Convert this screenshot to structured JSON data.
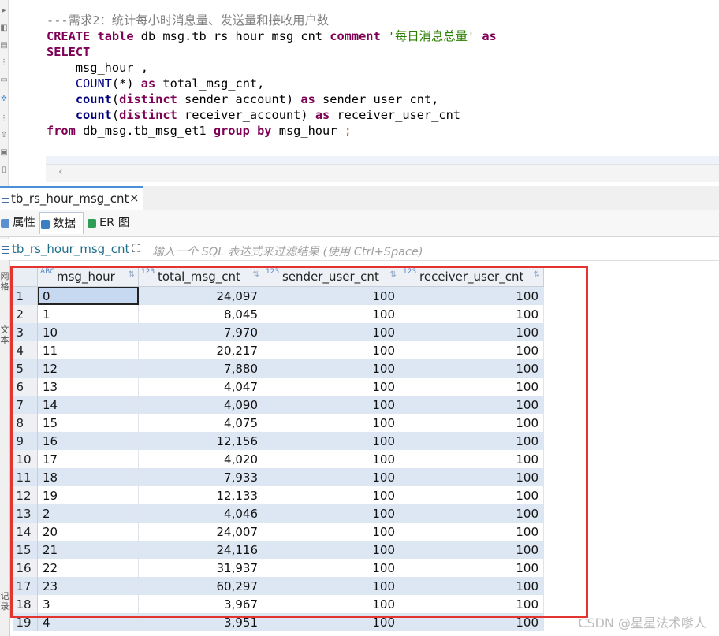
{
  "editor": {
    "comment": "---需求2：统计每小时消息量、发送量和接收用户数",
    "line2": {
      "kw1": "CREATE",
      "kw2": "table",
      "name": "db_msg.tb_rs_hour_msg_cnt",
      "kw3": "comment",
      "str": "'每日消息总量'",
      "kw4": "as"
    },
    "line3": "SELECT",
    "line4": "    msg_hour ,",
    "line5": {
      "fn": "COUNT",
      "rest": "(*)",
      "kw": "as",
      "alias": "total_msg_cnt,"
    },
    "line6": {
      "fn": "count",
      "open": "(",
      "kw1": "distinct",
      "col": "sender_account)",
      "kw2": "as",
      "alias": "sender_user_cnt,"
    },
    "line7": {
      "fn": "count",
      "open": "(",
      "kw1": "distinct",
      "col": "receiver_account)",
      "kw2": "as",
      "alias": "receiver_user_cnt"
    },
    "line8": {
      "kw1": "from",
      "table": "db_msg.tb_msg_et1",
      "kw2": "group by",
      "col": "msg_hour",
      "end": ";"
    }
  },
  "result_tab": {
    "label": "tb_rs_hour_msg_cnt",
    "close": "×"
  },
  "sub_tabs": {
    "props": "属性",
    "data": "数据",
    "er": "ER 图"
  },
  "filter": {
    "table_name": "tb_rs_hour_msg_cnt",
    "placeholder": "输入一个 SQL 表达式来过滤结果 (使用 Ctrl+Space)"
  },
  "grid": {
    "columns": [
      {
        "name": "msg_hour",
        "type": "ABC"
      },
      {
        "name": "total_msg_cnt",
        "type": "123"
      },
      {
        "name": "sender_user_cnt",
        "type": "123"
      },
      {
        "name": "receiver_user_cnt",
        "type": "123"
      }
    ],
    "rows": [
      [
        "1",
        "0",
        "24,097",
        "100",
        "100"
      ],
      [
        "2",
        "1",
        "8,045",
        "100",
        "100"
      ],
      [
        "3",
        "10",
        "7,970",
        "100",
        "100"
      ],
      [
        "4",
        "11",
        "20,217",
        "100",
        "100"
      ],
      [
        "5",
        "12",
        "7,880",
        "100",
        "100"
      ],
      [
        "6",
        "13",
        "4,047",
        "100",
        "100"
      ],
      [
        "7",
        "14",
        "4,090",
        "100",
        "100"
      ],
      [
        "8",
        "15",
        "4,075",
        "100",
        "100"
      ],
      [
        "9",
        "16",
        "12,156",
        "100",
        "100"
      ],
      [
        "10",
        "17",
        "4,020",
        "100",
        "100"
      ],
      [
        "11",
        "18",
        "7,933",
        "100",
        "100"
      ],
      [
        "12",
        "19",
        "12,133",
        "100",
        "100"
      ],
      [
        "13",
        "2",
        "4,046",
        "100",
        "100"
      ],
      [
        "14",
        "20",
        "24,007",
        "100",
        "100"
      ],
      [
        "15",
        "21",
        "24,116",
        "100",
        "100"
      ],
      [
        "16",
        "22",
        "31,937",
        "100",
        "100"
      ],
      [
        "17",
        "23",
        "60,297",
        "100",
        "100"
      ],
      [
        "18",
        "3",
        "3,967",
        "100",
        "100"
      ],
      [
        "19",
        "4",
        "3,951",
        "100",
        "100"
      ]
    ]
  },
  "side_labels": {
    "grid": "网格",
    "text": "文本",
    "record": "记录"
  },
  "watermark": "CSDN @星星法术嗲人",
  "colors": {
    "highlight_box": "#e3342f",
    "alt_row": "#dde7f3"
  }
}
